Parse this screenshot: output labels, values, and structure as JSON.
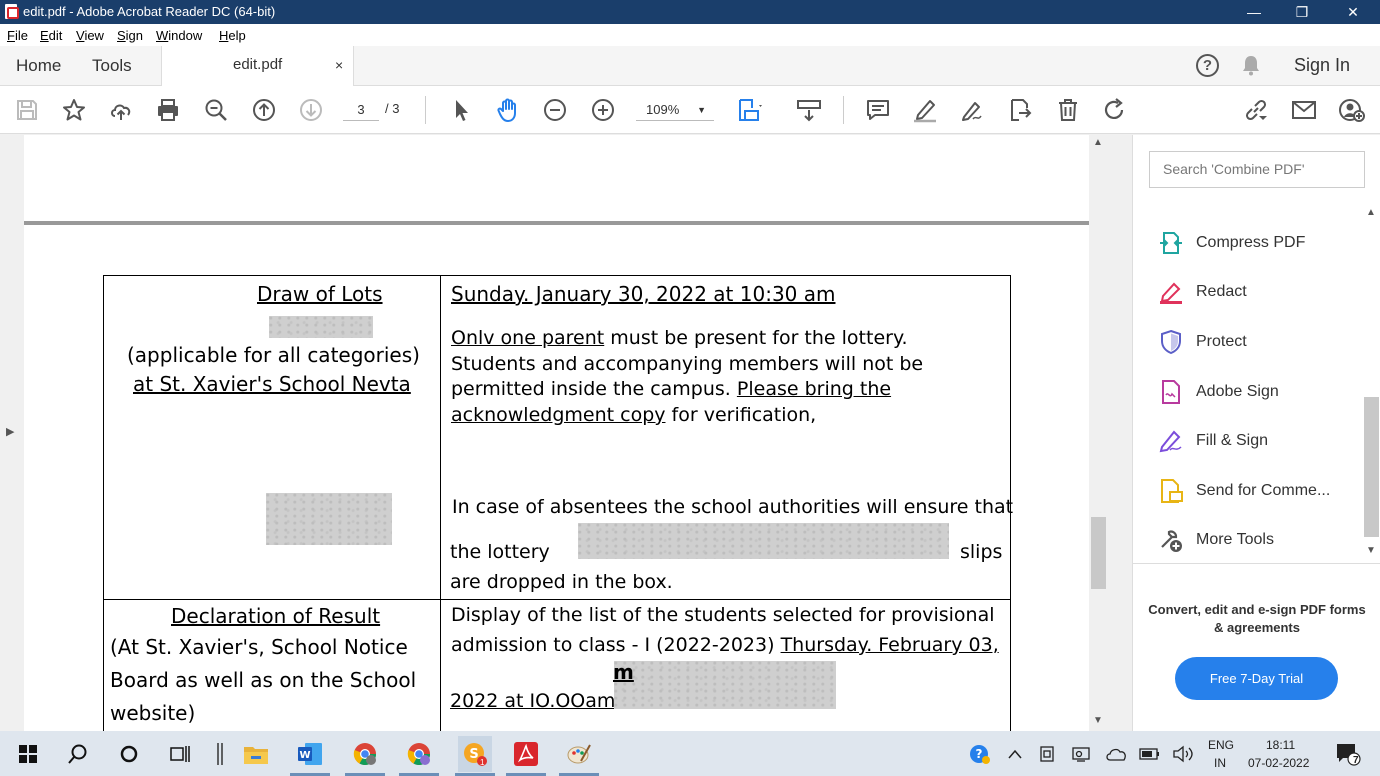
{
  "window": {
    "title": "edit.pdf - Adobe Acrobat Reader DC (64-bit)",
    "controls": {
      "minimize": "—",
      "restore": "❐",
      "close": "✕"
    }
  },
  "menu": [
    "File",
    "Edit",
    "View",
    "Sign",
    "Window",
    "Help"
  ],
  "tabs": {
    "home": "Home",
    "tools": "Tools",
    "document": "edit.pdf",
    "close": "×"
  },
  "account": {
    "help": "?",
    "signin": "Sign In"
  },
  "toolbar": {
    "page_current": "3",
    "page_total": "/ 3",
    "zoom": "109%"
  },
  "document": {
    "row1": {
      "left_heading": "Draw of Lots",
      "left_line1": "(applicable for all categories)",
      "left_line2": "at St. Xavier's School Nevta",
      "right_heading": "Sunday. January 30, 2022 at 10:30 am",
      "right_p1_u": "Onlv one parent",
      "right_p1_rest": " must be present for the lottery.",
      "right_p1_l2": "Students and accompanying members will not be",
      "right_p1_l3a": "permitted  inside  the  campus.  ",
      "right_p1_l3b": "Please  bring  the",
      "right_p1_l4a": "acknowledgment copy",
      "right_p1_l4b": " for verification,",
      "right_p2_l1": "In case of absentees the school authorities will ensure that",
      "right_p2_l2a": "the   lottery",
      "right_p2_l2b": "slips",
      "right_p2_l3": "are dropped in the box."
    },
    "row2": {
      "left_heading": "Declaration of Result",
      "left_line1": "(At  St.  Xavier's,  School  Notice",
      "left_line2": "Board as well as on the School",
      "left_line3": "website)",
      "right_l1": "Display of the list of the students selected for provisional",
      "right_l2a": "admission to class - I (2022-2023) ",
      "right_l2b": "Thursday. February 03,",
      "right_l3": "2022 at IO.OOam",
      "right_mark": "m"
    }
  },
  "right_pane": {
    "search_placeholder": "Search 'Combine PDF'",
    "tools": [
      {
        "label": "Compress PDF",
        "icon": "compress-icon",
        "color": "#1fa5a0"
      },
      {
        "label": "Redact",
        "icon": "redact-icon",
        "color": "#e0325b"
      },
      {
        "label": "Protect",
        "icon": "shield-icon",
        "color": "#5b5fc7"
      },
      {
        "label": "Adobe Sign",
        "icon": "adobe-sign-icon",
        "color": "#b83a9e"
      },
      {
        "label": "Fill & Sign",
        "icon": "fill-sign-icon",
        "color": "#7b4ddb"
      },
      {
        "label": "Send for Comme...",
        "icon": "send-comment-icon",
        "color": "#e8b515"
      },
      {
        "label": "More Tools",
        "icon": "more-tools-icon",
        "color": "#555555"
      }
    ],
    "promo": "Convert, edit and e-sign PDF forms & agreements",
    "trial_button": "Free 7-Day Trial"
  },
  "taskbar": {
    "lang_top": "ENG",
    "lang_bottom": "IN",
    "time": "18:11",
    "date": "07-02-2022",
    "notifications": "7",
    "skype_badge": "1"
  },
  "colors": {
    "titlebar": "#1a3e6b",
    "accent": "#2680eb",
    "pdf_red": "#d9262c"
  }
}
